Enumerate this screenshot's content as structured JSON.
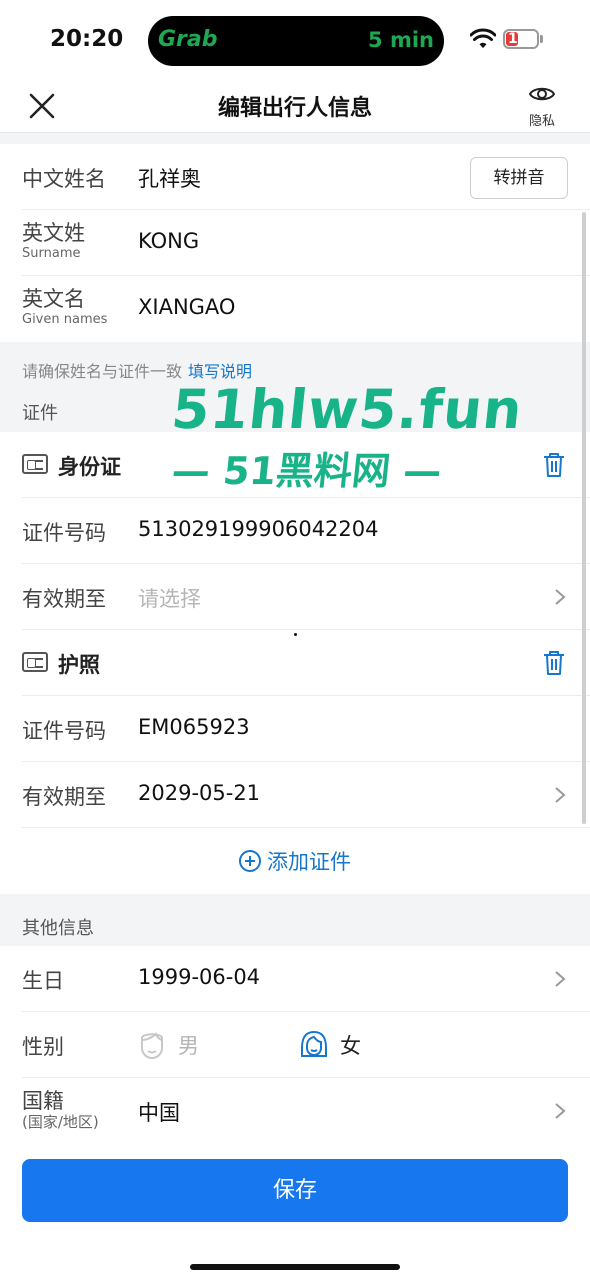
{
  "status_bar": {
    "time": "20:20",
    "island_app": "Grab",
    "island_eta": "5 min",
    "battery": "11"
  },
  "nav": {
    "title": "编辑出行人信息",
    "privacy_label": "隐私"
  },
  "name_section": {
    "chinese_name_label": "中文姓名",
    "chinese_name_value": "孔祥奥",
    "pinyin_button": "转拼音",
    "surname_label": "英文姓",
    "surname_sub": "Surname",
    "surname_value": "KONG",
    "given_label": "英文名",
    "given_sub": "Given names",
    "given_value": "XIANGAO",
    "hint_text": "请确保姓名与证件一致",
    "hint_link": "填写说明"
  },
  "documents": {
    "section_title": "证件",
    "items": [
      {
        "type_name": "身份证",
        "number_label": "证件号码",
        "number_value": "513029199906042204",
        "expiry_label": "有效期至",
        "expiry_value": "请选择"
      },
      {
        "type_name": "护照",
        "number_label": "证件号码",
        "number_value": "EM065923",
        "expiry_label": "有效期至",
        "expiry_value": "2029-05-21"
      }
    ],
    "add_label": "添加证件"
  },
  "other_info": {
    "section_title": "其他信息",
    "birthday_label": "生日",
    "birthday_value": "1999-06-04",
    "gender_label": "性别",
    "gender_male": "男",
    "gender_female": "女",
    "gender_selected": "女",
    "nationality_label": "国籍",
    "nationality_sub": "(国家/地区)",
    "nationality_value": "中国"
  },
  "save_button": "保存",
  "watermark": {
    "line1": "51hlw5.fun",
    "line2": "— 51黑料网 —"
  },
  "colors": {
    "accent": "#1677ee",
    "link": "#1677cc",
    "watermark": "#19b38a"
  }
}
